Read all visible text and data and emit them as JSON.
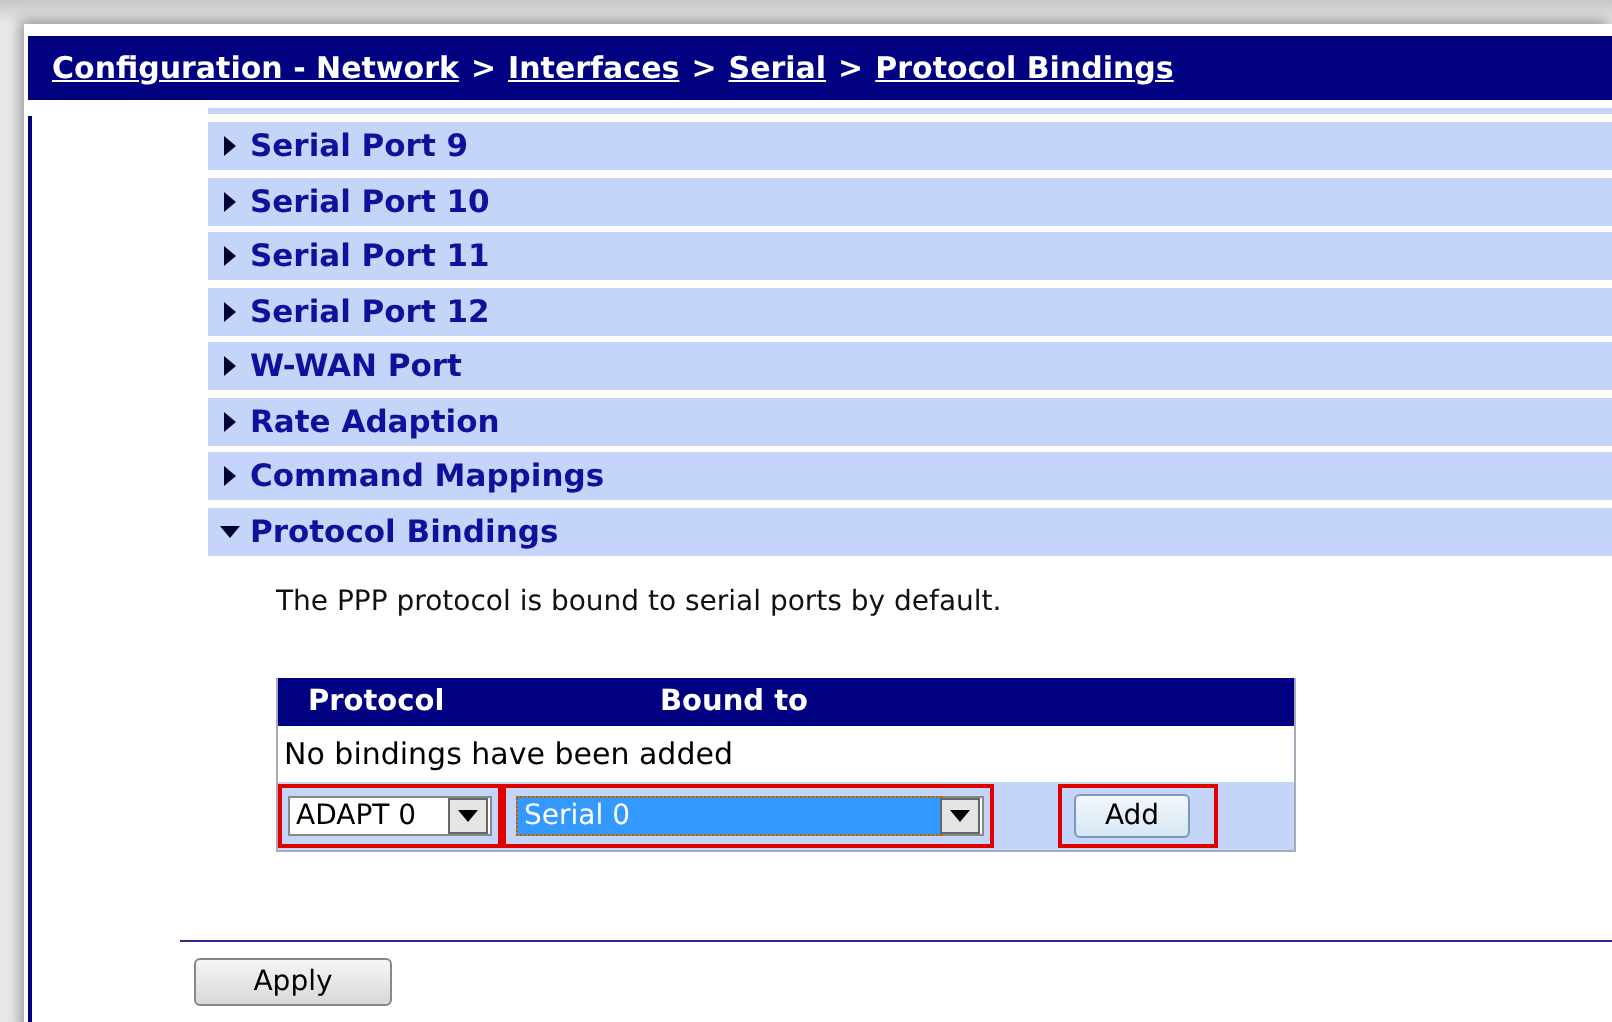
{
  "breadcrumb": [
    {
      "label": "Configuration - Network",
      "kind": "link"
    },
    {
      "label": ">",
      "kind": "separator"
    },
    {
      "label": "Interfaces",
      "kind": "link"
    },
    {
      "label": ">",
      "kind": "separator"
    },
    {
      "label": "Serial",
      "kind": "link"
    },
    {
      "label": ">",
      "kind": "separator"
    },
    {
      "label": "Protocol Bindings",
      "kind": "link"
    }
  ],
  "sections": [
    {
      "label": "Serial Port 9",
      "expanded": false
    },
    {
      "label": "Serial Port 10",
      "expanded": false
    },
    {
      "label": "Serial Port 11",
      "expanded": false
    },
    {
      "label": "Serial Port 12",
      "expanded": false
    },
    {
      "label": "W-WAN Port",
      "expanded": false
    },
    {
      "label": "Rate Adaption",
      "expanded": false
    },
    {
      "label": "Command Mappings",
      "expanded": false
    },
    {
      "label": "Protocol Bindings",
      "expanded": true
    }
  ],
  "description": "The PPP protocol is bound to serial ports by default.",
  "table": {
    "columns": [
      "Protocol",
      "Bound to"
    ],
    "empty_message": "No bindings have been added"
  },
  "form": {
    "protocol": {
      "value": "ADAPT 0",
      "highlighted": true
    },
    "bound_to": {
      "value": "Serial 0",
      "focused": true,
      "highlighted": true
    },
    "add_button": {
      "label": "Add",
      "highlighted": true
    }
  },
  "apply_button": "Apply"
}
